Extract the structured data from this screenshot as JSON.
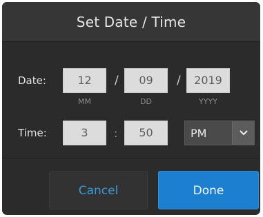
{
  "dialog": {
    "title": "Set Date / Time",
    "date": {
      "label": "Date:",
      "month": "12",
      "day": "09",
      "year": "2019",
      "separator": "/",
      "month_hint": "MM",
      "day_hint": "DD",
      "year_hint": "YYYY"
    },
    "time": {
      "label": "Time:",
      "hour": "3",
      "minute": "50",
      "separator": ":",
      "ampm_selected": "PM"
    },
    "buttons": {
      "cancel": "Cancel",
      "done": "Done"
    }
  },
  "colors": {
    "dialog_bg": "#2b2b2b",
    "header_bg": "#363636",
    "field_bg": "#dcdcdc",
    "accent": "#1d7fd0",
    "link_text": "#3a9ad9"
  },
  "icons": {
    "ampm_dropdown": "chevron-down-icon"
  }
}
